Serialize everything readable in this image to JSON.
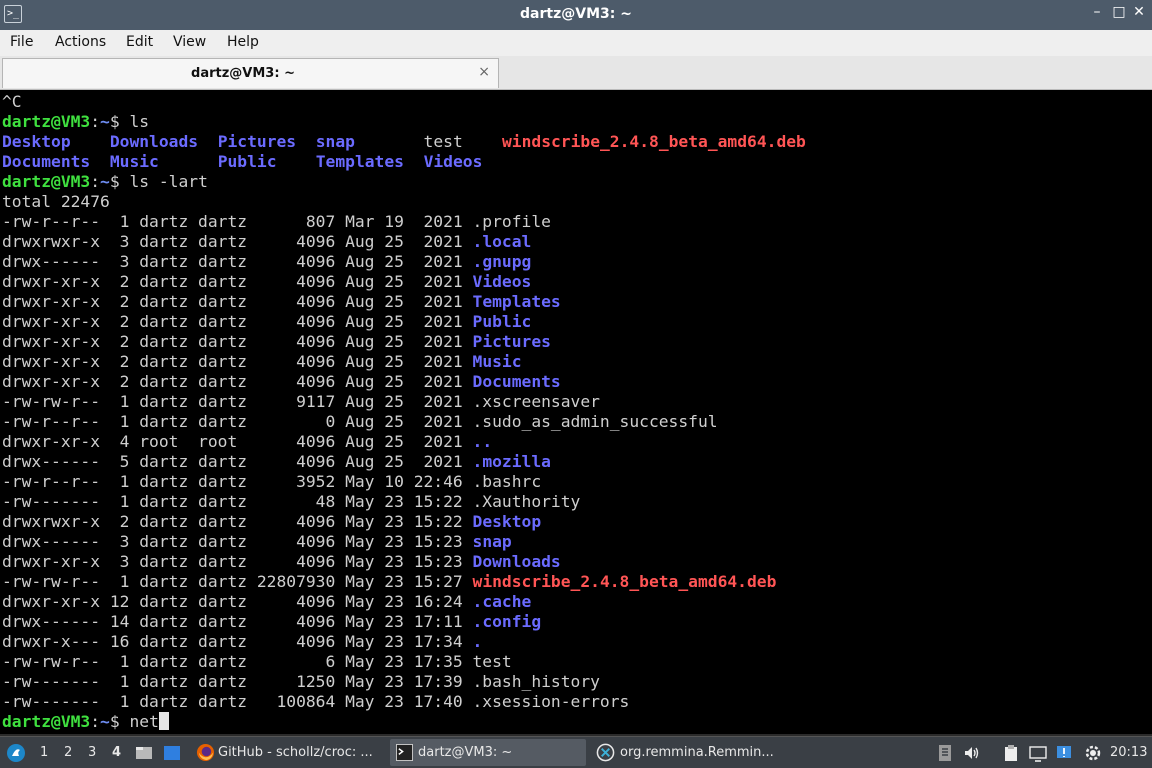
{
  "window": {
    "title": "dartz@VM3: ~",
    "controls": {
      "minimize": "–",
      "maximize": "□",
      "close": "✕"
    }
  },
  "menu": [
    "File",
    "Actions",
    "Edit",
    "View",
    "Help"
  ],
  "tab": {
    "label": "dartz@VM3: ~",
    "close": "×"
  },
  "terminal": {
    "lines": [
      [
        {
          "t": "^C",
          "c": "plain"
        }
      ],
      [
        {
          "t": "dartz@VM3",
          "c": "prompt"
        },
        {
          "t": ":",
          "c": "plain"
        },
        {
          "t": "~",
          "c": "ppath"
        },
        {
          "t": "$ ls",
          "c": "plain"
        }
      ],
      [
        {
          "t": "Desktop",
          "c": "dir"
        },
        {
          "t": "    ",
          "c": "plain"
        },
        {
          "t": "Downloads",
          "c": "dir"
        },
        {
          "t": "  ",
          "c": "plain"
        },
        {
          "t": "Pictures",
          "c": "dir"
        },
        {
          "t": "  ",
          "c": "plain"
        },
        {
          "t": "snap",
          "c": "dir"
        },
        {
          "t": "       test    ",
          "c": "plain"
        },
        {
          "t": "windscribe_2.4.8_beta_amd64.deb",
          "c": "deb"
        }
      ],
      [
        {
          "t": "Documents",
          "c": "dir"
        },
        {
          "t": "  ",
          "c": "plain"
        },
        {
          "t": "Music",
          "c": "dir"
        },
        {
          "t": "      ",
          "c": "plain"
        },
        {
          "t": "Public",
          "c": "dir"
        },
        {
          "t": "    ",
          "c": "plain"
        },
        {
          "t": "Templates",
          "c": "dir"
        },
        {
          "t": "  ",
          "c": "plain"
        },
        {
          "t": "Videos",
          "c": "dir"
        }
      ],
      [
        {
          "t": "dartz@VM3",
          "c": "prompt"
        },
        {
          "t": ":",
          "c": "plain"
        },
        {
          "t": "~",
          "c": "ppath"
        },
        {
          "t": "$ ls -lart",
          "c": "plain"
        }
      ],
      [
        {
          "t": "total 22476",
          "c": "plain"
        }
      ],
      [
        {
          "t": "-rw-r--r--  1 dartz dartz      807 Mar 19  2021 .profile",
          "c": "plain"
        }
      ],
      [
        {
          "t": "drwxrwxr-x  3 dartz dartz     4096 Aug 25  2021 ",
          "c": "plain"
        },
        {
          "t": ".local",
          "c": "dir"
        }
      ],
      [
        {
          "t": "drwx------  3 dartz dartz     4096 Aug 25  2021 ",
          "c": "plain"
        },
        {
          "t": ".gnupg",
          "c": "dir"
        }
      ],
      [
        {
          "t": "drwxr-xr-x  2 dartz dartz     4096 Aug 25  2021 ",
          "c": "plain"
        },
        {
          "t": "Videos",
          "c": "dir"
        }
      ],
      [
        {
          "t": "drwxr-xr-x  2 dartz dartz     4096 Aug 25  2021 ",
          "c": "plain"
        },
        {
          "t": "Templates",
          "c": "dir"
        }
      ],
      [
        {
          "t": "drwxr-xr-x  2 dartz dartz     4096 Aug 25  2021 ",
          "c": "plain"
        },
        {
          "t": "Public",
          "c": "dir"
        }
      ],
      [
        {
          "t": "drwxr-xr-x  2 dartz dartz     4096 Aug 25  2021 ",
          "c": "plain"
        },
        {
          "t": "Pictures",
          "c": "dir"
        }
      ],
      [
        {
          "t": "drwxr-xr-x  2 dartz dartz     4096 Aug 25  2021 ",
          "c": "plain"
        },
        {
          "t": "Music",
          "c": "dir"
        }
      ],
      [
        {
          "t": "drwxr-xr-x  2 dartz dartz     4096 Aug 25  2021 ",
          "c": "plain"
        },
        {
          "t": "Documents",
          "c": "dir"
        }
      ],
      [
        {
          "t": "-rw-rw-r--  1 dartz dartz     9117 Aug 25  2021 .xscreensaver",
          "c": "plain"
        }
      ],
      [
        {
          "t": "-rw-r--r--  1 dartz dartz        0 Aug 25  2021 .sudo_as_admin_successful",
          "c": "plain"
        }
      ],
      [
        {
          "t": "drwxr-xr-x  4 root  root      4096 Aug 25  2021 ",
          "c": "plain"
        },
        {
          "t": "..",
          "c": "dir"
        }
      ],
      [
        {
          "t": "drwx------  5 dartz dartz     4096 Aug 25  2021 ",
          "c": "plain"
        },
        {
          "t": ".mozilla",
          "c": "dir"
        }
      ],
      [
        {
          "t": "-rw-r--r--  1 dartz dartz     3952 May 10 22:46 .bashrc",
          "c": "plain"
        }
      ],
      [
        {
          "t": "-rw-------  1 dartz dartz       48 May 23 15:22 .Xauthority",
          "c": "plain"
        }
      ],
      [
        {
          "t": "drwxrwxr-x  2 dartz dartz     4096 May 23 15:22 ",
          "c": "plain"
        },
        {
          "t": "Desktop",
          "c": "dir"
        }
      ],
      [
        {
          "t": "drwx------  3 dartz dartz     4096 May 23 15:23 ",
          "c": "plain"
        },
        {
          "t": "snap",
          "c": "dir"
        }
      ],
      [
        {
          "t": "drwxr-xr-x  3 dartz dartz     4096 May 23 15:23 ",
          "c": "plain"
        },
        {
          "t": "Downloads",
          "c": "dir"
        }
      ],
      [
        {
          "t": "-rw-rw-r--  1 dartz dartz 22807930 May 23 15:27 ",
          "c": "plain"
        },
        {
          "t": "windscribe_2.4.8_beta_amd64.deb",
          "c": "deb"
        }
      ],
      [
        {
          "t": "drwxr-xr-x 12 dartz dartz     4096 May 23 16:24 ",
          "c": "plain"
        },
        {
          "t": ".cache",
          "c": "dir"
        }
      ],
      [
        {
          "t": "drwx------ 14 dartz dartz     4096 May 23 17:11 ",
          "c": "plain"
        },
        {
          "t": ".config",
          "c": "dir"
        }
      ],
      [
        {
          "t": "drwxr-x--- 16 dartz dartz     4096 May 23 17:34 ",
          "c": "plain"
        },
        {
          "t": ".",
          "c": "dir"
        }
      ],
      [
        {
          "t": "-rw-rw-r--  1 dartz dartz        6 May 23 17:35 test",
          "c": "plain"
        }
      ],
      [
        {
          "t": "-rw-------  1 dartz dartz     1250 May 23 17:39 .bash_history",
          "c": "plain"
        }
      ],
      [
        {
          "t": "-rw-------  1 dartz dartz   100864 May 23 17:40 .xsession-errors",
          "c": "plain"
        }
      ],
      [
        {
          "t": "dartz@VM3",
          "c": "prompt"
        },
        {
          "t": ":",
          "c": "plain"
        },
        {
          "t": "~",
          "c": "ppath"
        },
        {
          "t": "$ net",
          "c": "plain"
        }
      ]
    ]
  },
  "taskbar": {
    "workspaces": [
      "1",
      "2",
      "3",
      "4"
    ],
    "active_workspace": "4",
    "tasks": [
      {
        "label": "GitHub - schollz/croc: ...",
        "icon": "firefox-icon"
      },
      {
        "label": "dartz@VM3: ~",
        "icon": "terminal-icon",
        "active": true
      },
      {
        "label": "org.remmina.Remmin...",
        "icon": "remmina-icon"
      }
    ],
    "clock": "20:13"
  },
  "colors": {
    "prompt_user": "#3fe03f",
    "prompt_path": "#6e8df2",
    "directory": "#6b6bff",
    "package": "#ff5555",
    "text": "#cfcfcf",
    "titlebar": "#4d5b6a",
    "taskbar": "#3a3f45"
  }
}
